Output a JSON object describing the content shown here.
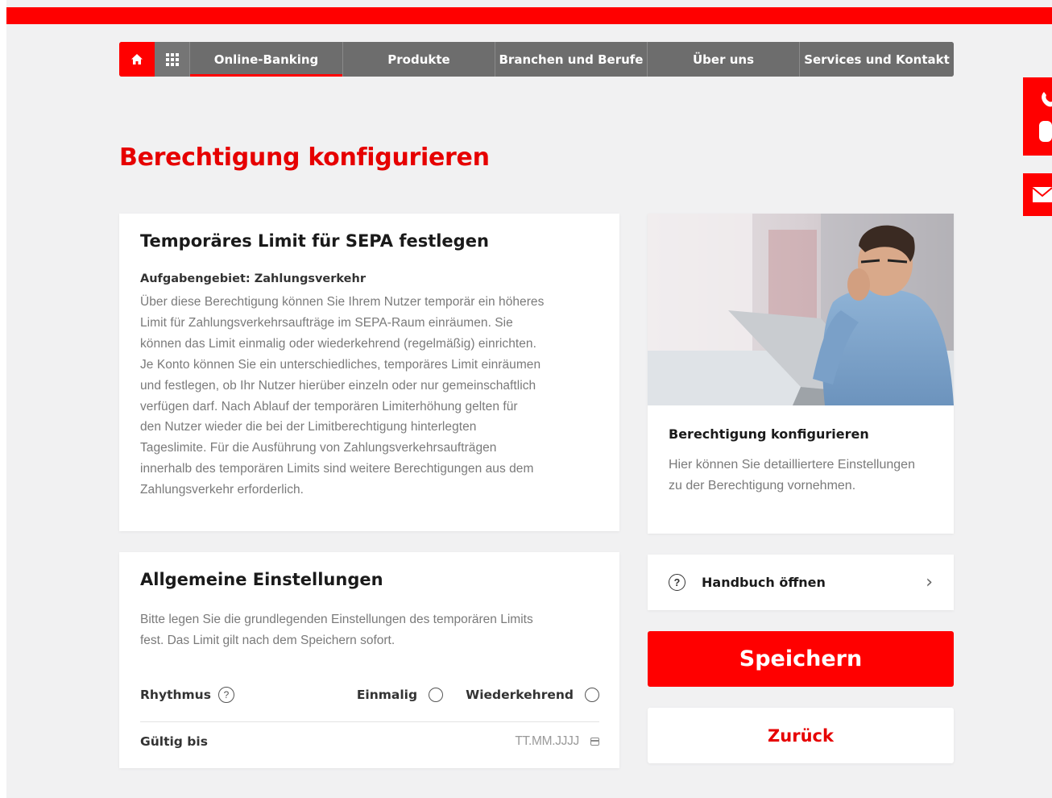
{
  "nav": {
    "items": [
      {
        "label": "Online-Banking",
        "active": true
      },
      {
        "label": "Produkte",
        "active": false
      },
      {
        "label": "Branchen und Berufe",
        "active": false
      },
      {
        "label": "Über uns",
        "active": false
      },
      {
        "label": "Services und Kontakt",
        "active": false
      }
    ]
  },
  "page": {
    "title": "Berechtigung konfigurieren"
  },
  "sepa_card": {
    "title": "Temporäres Limit für SEPA festlegen",
    "subtitle": "Aufgabengebiet: Zahlungsverkehr",
    "lines": [
      "Über diese Berechtigung können Sie Ihrem Nutzer temporär ein höheres",
      "Limit für Zahlungsverkehrsaufträge im SEPA-Raum einräumen. Sie",
      "können das Limit einmalig oder wiederkehrend (regelmäßig) einrichten.",
      "Je Konto können Sie ein unterschiedliches, temporäres Limit einräumen",
      "und festlegen, ob Ihr Nutzer hierüber einzeln oder nur gemeinschaftlich",
      "verfügen darf. Nach Ablauf der temporären Limiterhöhung gelten für",
      "den Nutzer wieder die bei der Limitberechtigung hinterlegten",
      "Tageslimite. Für die Ausführung von Zahlungsverkehrsaufträgen",
      "innerhalb des temporären Limits sind weitere Berechtigungen aus dem",
      "Zahlungsverkehr erforderlich."
    ]
  },
  "info_card": {
    "title": "Berechtigung konfigurieren",
    "text": "Hier können Sie detailliertere Einstellungen zu der Berechtigung vornehmen."
  },
  "settings_card": {
    "title": "Allgemeine Einstellungen",
    "description_lines": [
      "Bitte legen Sie die grundlegenden Einstellungen des temporären Limits",
      "fest. Das Limit gilt nach dem Speichern sofort."
    ],
    "rhythm_label": "Rhythmus",
    "option_once": "Einmalig",
    "option_recurring": "Wiederkehrend",
    "valid_until_label": "Gültig bis",
    "date_placeholder": "TT.MM.JJJJ"
  },
  "manual": {
    "label": "Handbuch öffnen"
  },
  "actions": {
    "save_label": "Speichern",
    "back_label": "Zurück"
  },
  "colors": {
    "brand_red": "#ff0000",
    "nav_gray": "#6d6d6d",
    "page_bg": "#f1f1f2"
  }
}
